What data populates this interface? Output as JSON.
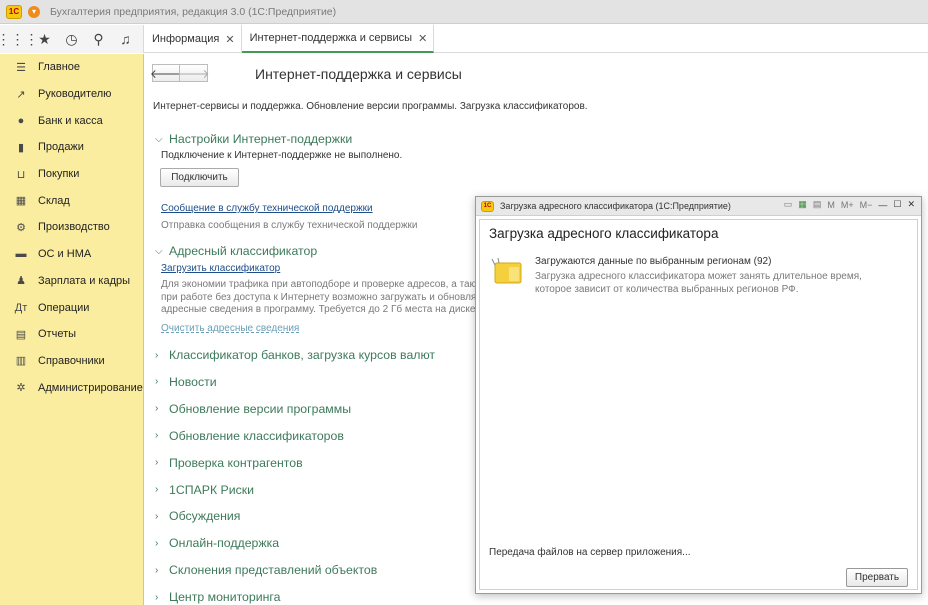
{
  "window": {
    "title": "Бухгалтерия предприятия, редакция 3.0  (1С:Предприятие)",
    "logo": "1С"
  },
  "toolbar": {
    "icons": [
      "apps-grid-icon",
      "star-icon",
      "history-icon",
      "search-icon",
      "bell-icon"
    ]
  },
  "tabs": [
    {
      "label": "Информация",
      "close": "✕"
    },
    {
      "label": "Интернет-поддержка и сервисы",
      "close": "✕"
    }
  ],
  "sidebar": {
    "items": [
      {
        "label": "Главное",
        "icon": "menu-icon",
        "glyph": "☰"
      },
      {
        "label": "Руководителю",
        "icon": "trend-icon",
        "glyph": "↗"
      },
      {
        "label": "Банк и касса",
        "icon": "coin-icon",
        "glyph": "●"
      },
      {
        "label": "Продажи",
        "icon": "bag-icon",
        "glyph": "▮"
      },
      {
        "label": "Покупки",
        "icon": "cart-icon",
        "glyph": "⊔"
      },
      {
        "label": "Склад",
        "icon": "warehouse-icon",
        "glyph": "▦"
      },
      {
        "label": "Производство",
        "icon": "factory-icon",
        "glyph": "⚙"
      },
      {
        "label": "ОС и НМА",
        "icon": "truck-icon",
        "glyph": "▬"
      },
      {
        "label": "Зарплата и кадры",
        "icon": "people-icon",
        "glyph": "♟"
      },
      {
        "label": "Операции",
        "icon": "operations-icon",
        "glyph": "Дт"
      },
      {
        "label": "Отчеты",
        "icon": "report-icon",
        "glyph": "▤"
      },
      {
        "label": "Справочники",
        "icon": "book-icon",
        "glyph": "▥"
      },
      {
        "label": "Администрирование",
        "icon": "gear-icon",
        "glyph": "✲"
      }
    ]
  },
  "main": {
    "title": "Интернет-поддержка и сервисы",
    "subtitle": "Интернет-сервисы и поддержка. Обновление версии программы. Загрузка классификаторов.",
    "settings": {
      "header": "Настройки Интернет-поддержки",
      "status": "Подключение к Интернет-поддержке не выполнено.",
      "connect_button": "Подключить",
      "support_link": "Сообщение в службу технической поддержки",
      "support_hint": "Отправка сообщения в службу технической поддержки"
    },
    "address": {
      "header": "Адресный классификатор",
      "load_link": "Загрузить классификатор",
      "hint_lines": [
        "Для экономии трафика при автоподборе и проверке адресов, а такж",
        "при работе без доступа к Интернету возможно загружать и обновлят",
        "адресные сведения в программу. Требуется до 2 Гб места на диске"
      ],
      "clear_link": "Очистить адресные сведения"
    },
    "groups": [
      "Классификатор банков, загрузка курсов валют",
      "Новости",
      "Обновление версии программы",
      "Обновление классификаторов",
      "Проверка контрагентов",
      "1СПАРК Риски",
      "Обсуждения",
      "Онлайн-поддержка",
      "Склонения представлений объектов",
      "Центр мониторинга"
    ],
    "chevron_open": "⌵",
    "chevron_closed": "›"
  },
  "dialog": {
    "title": "Загрузка адресного классификатора  (1С:Предприятие)",
    "heading": "Загрузка адресного классификатора",
    "status": "Загружаются данные по выбранным регионам (92)",
    "hint_lines": [
      "Загрузка адресного классификатора может занять длительное время,",
      "которое зависит от количества выбранных регионов РФ."
    ],
    "transfer": "Передача файлов на сервер приложения...",
    "abort_button": "Прервать",
    "tools": [
      "M",
      "M+",
      "M−",
      "—",
      "☐",
      "✕"
    ]
  },
  "colors": {
    "sidebar": "#fbeda0",
    "accent": "#3d7a5a",
    "link": "#1d4d8a"
  }
}
